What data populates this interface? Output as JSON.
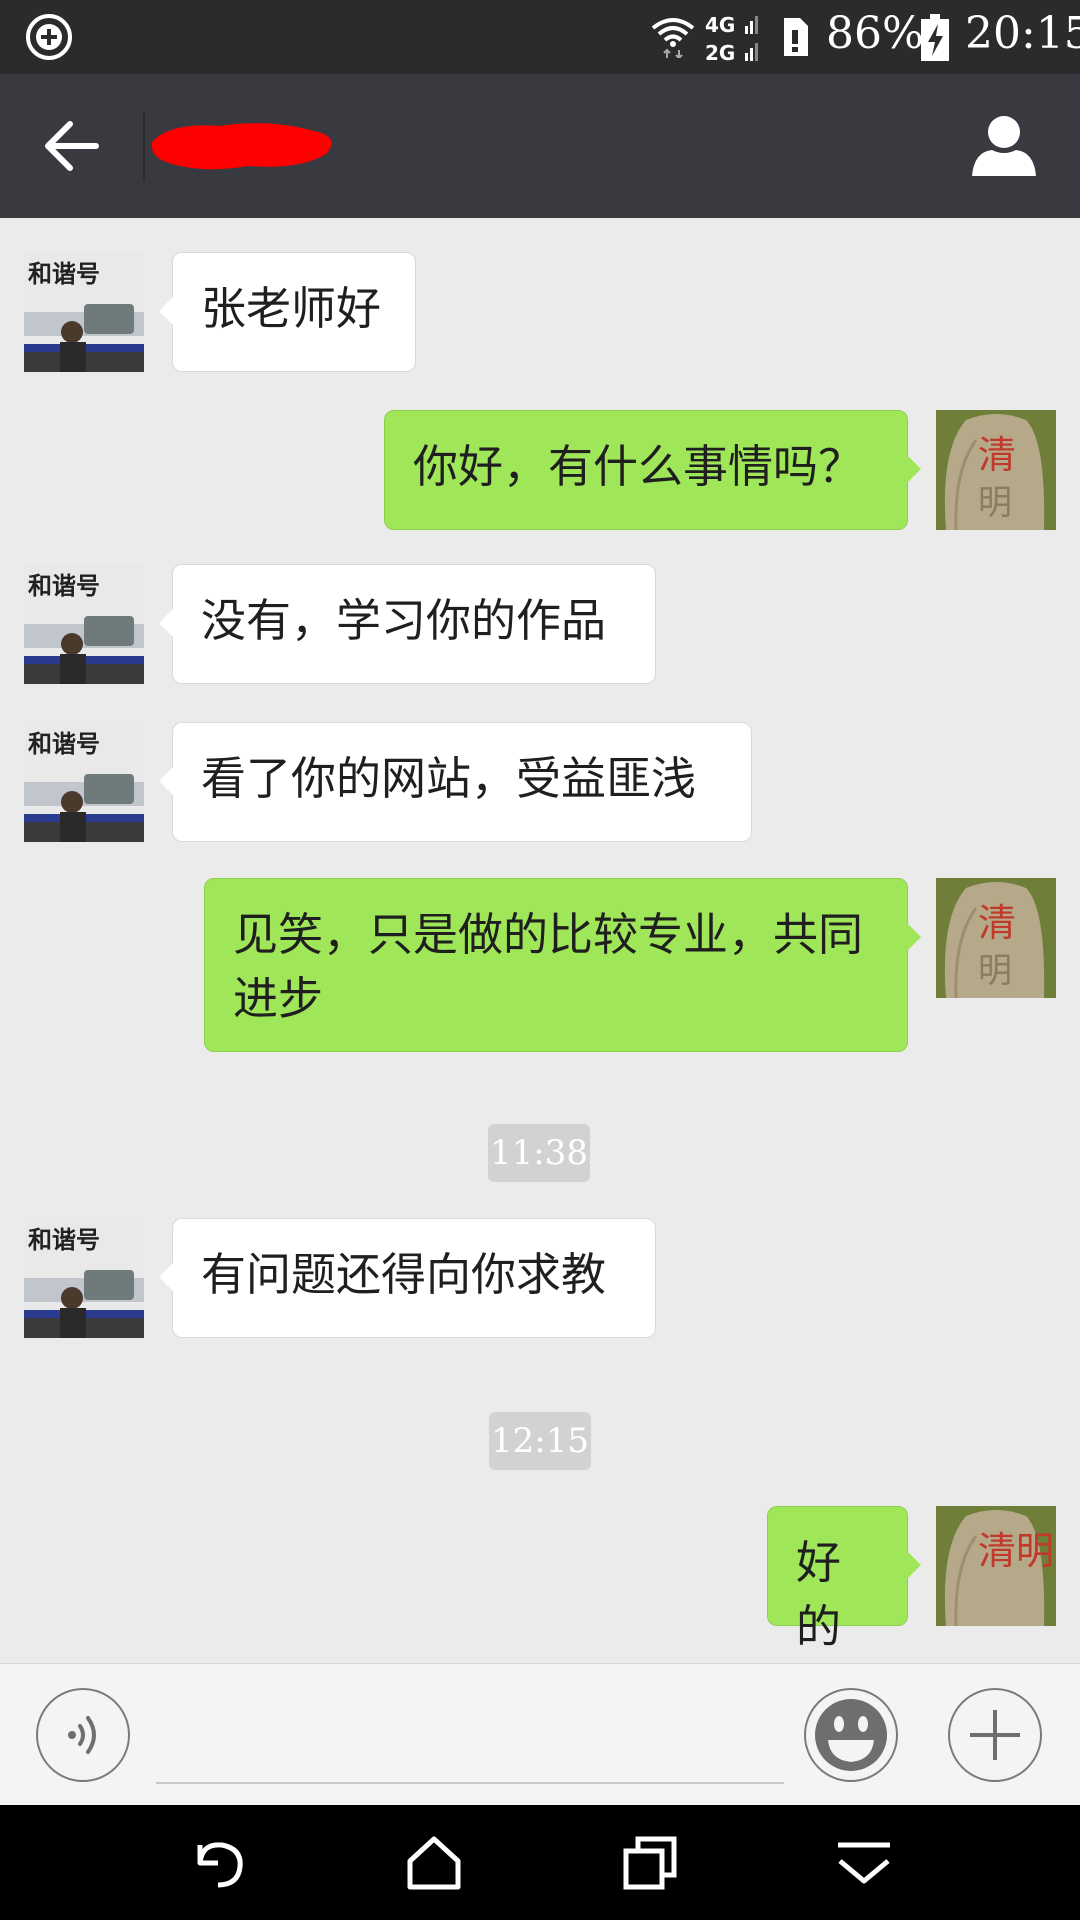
{
  "status_bar": {
    "battery_percent": "86%",
    "time": "20:15",
    "network_labels": [
      "4G",
      "2G"
    ],
    "icons": [
      "add-circle-icon",
      "wifi-icon",
      "signal-icon",
      "sim-icon",
      "battery-charging-icon"
    ]
  },
  "header": {
    "contact_name": "",
    "back_icon": "arrow-left-icon",
    "profile_icon": "person-icon"
  },
  "chat": {
    "messages": [
      {
        "side": "in",
        "text": "张老师好"
      },
      {
        "side": "out",
        "text": "你好，有什么事情吗？"
      },
      {
        "side": "in",
        "text": "没有，学习你的作品"
      },
      {
        "side": "in",
        "text": "看了你的网站，受益匪浅"
      },
      {
        "side": "out",
        "text": "见笑，只是做的比较专业，共同进步"
      },
      {
        "side": "in",
        "text": "有问题还得向你求教"
      },
      {
        "side": "out",
        "text": "好的"
      }
    ],
    "timestamps": [
      "11:38",
      "12:15"
    ],
    "avatar_text": {
      "contact_banner": "和谐号",
      "self_stone": "清明"
    }
  },
  "input_bar": {
    "placeholder": "",
    "icons": [
      "voice-icon",
      "emoji-icon",
      "plus-icon"
    ]
  },
  "nav_bar": {
    "icons": [
      "back-icon",
      "home-icon",
      "recents-icon",
      "menu-down-icon"
    ]
  },
  "colors": {
    "status_bar": "#2b2b2d",
    "title_bar": "#393a3f",
    "chat_bg": "#ebebeb",
    "bubble_out": "#9fe658",
    "bubble_in": "#ffffff",
    "redaction": "#ff0000"
  }
}
